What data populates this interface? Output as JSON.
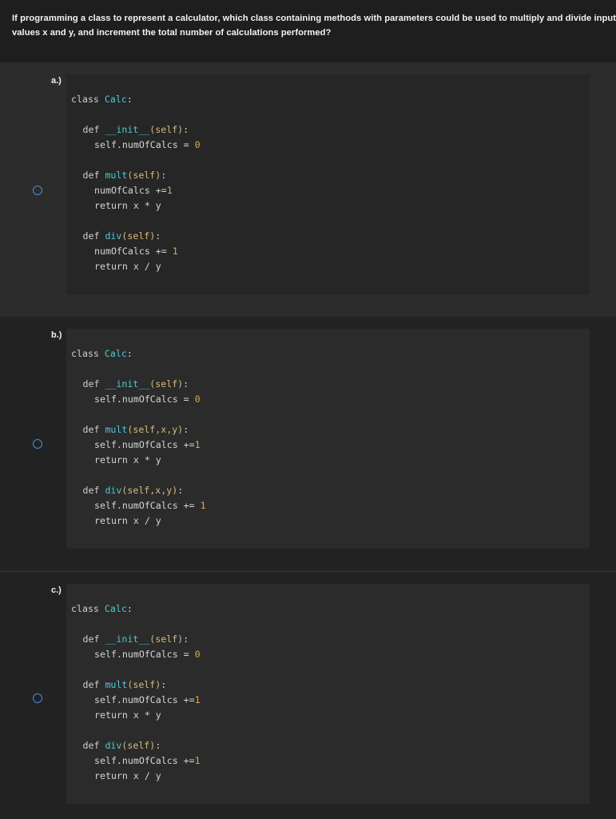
{
  "question": {
    "line1": "If programming a class to represent a calculator, which class containing methods with parameters could be used to multiply and divide input",
    "line2": "values x and y, and increment the total number of calculations performed?"
  },
  "colors": {
    "radio_border": "#3f8fe0",
    "code_class_name": "#4ec9d6",
    "code_self": "#d7ba7d",
    "code_number": "#e5a845"
  },
  "options": [
    {
      "letter": "a.)",
      "code": {
        "class_kw": "class",
        "class_name": "Calc",
        "colon": ":",
        "init_def": "def",
        "init_name": "__init__",
        "init_params": "(self)",
        "init_colon": ":",
        "init_body_pre": "self.numOfCalcs = ",
        "init_body_num": "0",
        "mult_def": "def",
        "mult_name": "mult",
        "mult_params": "(self)",
        "mult_colon": ":",
        "mult_inc_pre": "numOfCalcs +=",
        "mult_inc_num": "1",
        "mult_return": "return x * y",
        "div_def": "def",
        "div_name": "div",
        "div_params": "(self)",
        "div_colon": ":",
        "div_inc_pre": "numOfCalcs += ",
        "div_inc_num": "1",
        "div_return": "return x / y"
      }
    },
    {
      "letter": "b.)",
      "code": {
        "class_kw": "class",
        "class_name": "Calc",
        "colon": ":",
        "init_def": "def",
        "init_name": "__init__",
        "init_params": "(self)",
        "init_colon": ":",
        "init_body_pre": "self.numOfCalcs = ",
        "init_body_num": "0",
        "mult_def": "def",
        "mult_name": "mult",
        "mult_params": "(self,x,y)",
        "mult_colon": ":",
        "mult_inc_pre": "self.numOfCalcs +=",
        "mult_inc_num": "1",
        "mult_return": "return x * y",
        "div_def": "def",
        "div_name": "div",
        "div_params": "(self,x,y)",
        "div_colon": ":",
        "div_inc_pre": "self.numOfCalcs += ",
        "div_inc_num": "1",
        "div_return": "return x / y"
      }
    },
    {
      "letter": "c.)",
      "code": {
        "class_kw": "class",
        "class_name": "Calc",
        "colon": ":",
        "init_def": "def",
        "init_name": "__init__",
        "init_params": "(self)",
        "init_colon": ":",
        "init_body_pre": "self.numOfCalcs = ",
        "init_body_num": "0",
        "mult_def": "def",
        "mult_name": "mult",
        "mult_params": "(self)",
        "mult_colon": ":",
        "mult_inc_pre": "self.numOfCalcs +=",
        "mult_inc_num": "1",
        "mult_return": "return x * y",
        "div_def": "def",
        "div_name": "div",
        "div_params": "(self)",
        "div_colon": ":",
        "div_inc_pre": "self.numOfCalcs +=",
        "div_inc_num": "1",
        "div_return": "return x / y"
      }
    }
  ]
}
